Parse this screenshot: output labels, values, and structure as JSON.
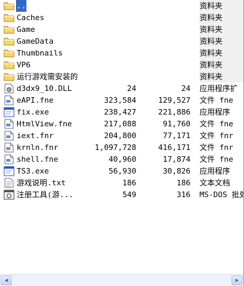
{
  "files": [
    {
      "name": "..",
      "size": "",
      "packed": "",
      "type": "资料夹",
      "icon": "folder-up-icon",
      "kind": "folder",
      "selected": true
    },
    {
      "name": "Caches",
      "size": "",
      "packed": "",
      "type": "资料夹",
      "icon": "folder-icon",
      "kind": "folder"
    },
    {
      "name": "Game",
      "size": "",
      "packed": "",
      "type": "资料夹",
      "icon": "folder-icon",
      "kind": "folder"
    },
    {
      "name": "GameData",
      "size": "",
      "packed": "",
      "type": "资料夹",
      "icon": "folder-icon",
      "kind": "folder"
    },
    {
      "name": "Thumbnails",
      "size": "",
      "packed": "",
      "type": "资料夹",
      "icon": "folder-icon",
      "kind": "folder"
    },
    {
      "name": "VP6",
      "size": "",
      "packed": "",
      "type": "资料夹",
      "icon": "folder-icon",
      "kind": "folder"
    },
    {
      "name": "运行游戏需安装的",
      "size": "",
      "packed": "",
      "type": "资料夹",
      "icon": "folder-icon",
      "kind": "folder"
    },
    {
      "name": "d3dx9_10.DLL",
      "size": "24",
      "packed": "24",
      "type": "应用程序扩",
      "icon": "dll-icon",
      "kind": "file"
    },
    {
      "name": "eAPI.fne",
      "size": "323,584",
      "packed": "129,527",
      "type": "文件 fne",
      "icon": "generic-file-icon",
      "kind": "file"
    },
    {
      "name": "fix.exe",
      "size": "238,427",
      "packed": "221,886",
      "type": "应用程序",
      "icon": "exe-icon",
      "kind": "file"
    },
    {
      "name": "HtmlView.fne",
      "size": "217,088",
      "packed": "91,760",
      "type": "文件 fne",
      "icon": "generic-file-icon",
      "kind": "file"
    },
    {
      "name": "iext.fnr",
      "size": "204,800",
      "packed": "77,171",
      "type": "文件 fnr",
      "icon": "generic-file-icon",
      "kind": "file"
    },
    {
      "name": "krnln.fnr",
      "size": "1,097,728",
      "packed": "416,171",
      "type": "文件 fnr",
      "icon": "generic-file-icon",
      "kind": "file"
    },
    {
      "name": "shell.fne",
      "size": "40,960",
      "packed": "17,874",
      "type": "文件 fne",
      "icon": "generic-file-icon",
      "kind": "file"
    },
    {
      "name": "TS3.exe",
      "size": "56,930",
      "packed": "30,826",
      "type": "应用程序",
      "icon": "exe-icon",
      "kind": "file"
    },
    {
      "name": "游戏说明.txt",
      "size": "186",
      "packed": "186",
      "type": "文本文档",
      "icon": "text-file-icon",
      "kind": "file"
    },
    {
      "name": "注册工具(游...",
      "size": "549",
      "packed": "316",
      "type": "MS-DOS 批处",
      "icon": "batch-file-icon",
      "kind": "file"
    }
  ],
  "colors": {
    "selection": "#316ac5",
    "folder": "#f5d76e",
    "scrollbar": "#c2d3f6"
  }
}
